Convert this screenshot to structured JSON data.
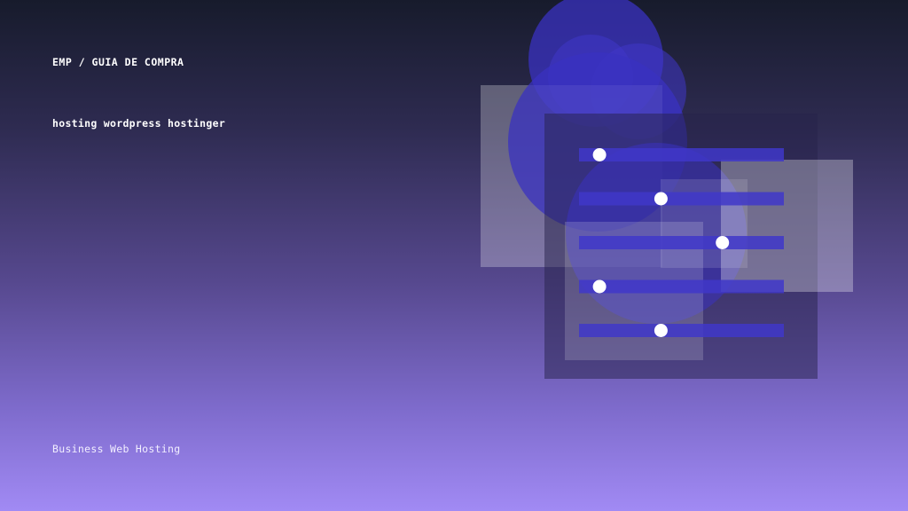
{
  "eyebrow": "EMP / GUIA DE COMPRA",
  "headline": "hosting wordpress hostinger",
  "footer": "Business Web Hosting",
  "graphic": {
    "slider_levels": [
      0.1,
      0.4,
      0.7,
      0.1,
      0.4
    ],
    "colors": {
      "accent": "#3f37c9",
      "circle": "#3a32c0",
      "panel": "#25214a",
      "translucent_white": "#ffffff"
    }
  }
}
